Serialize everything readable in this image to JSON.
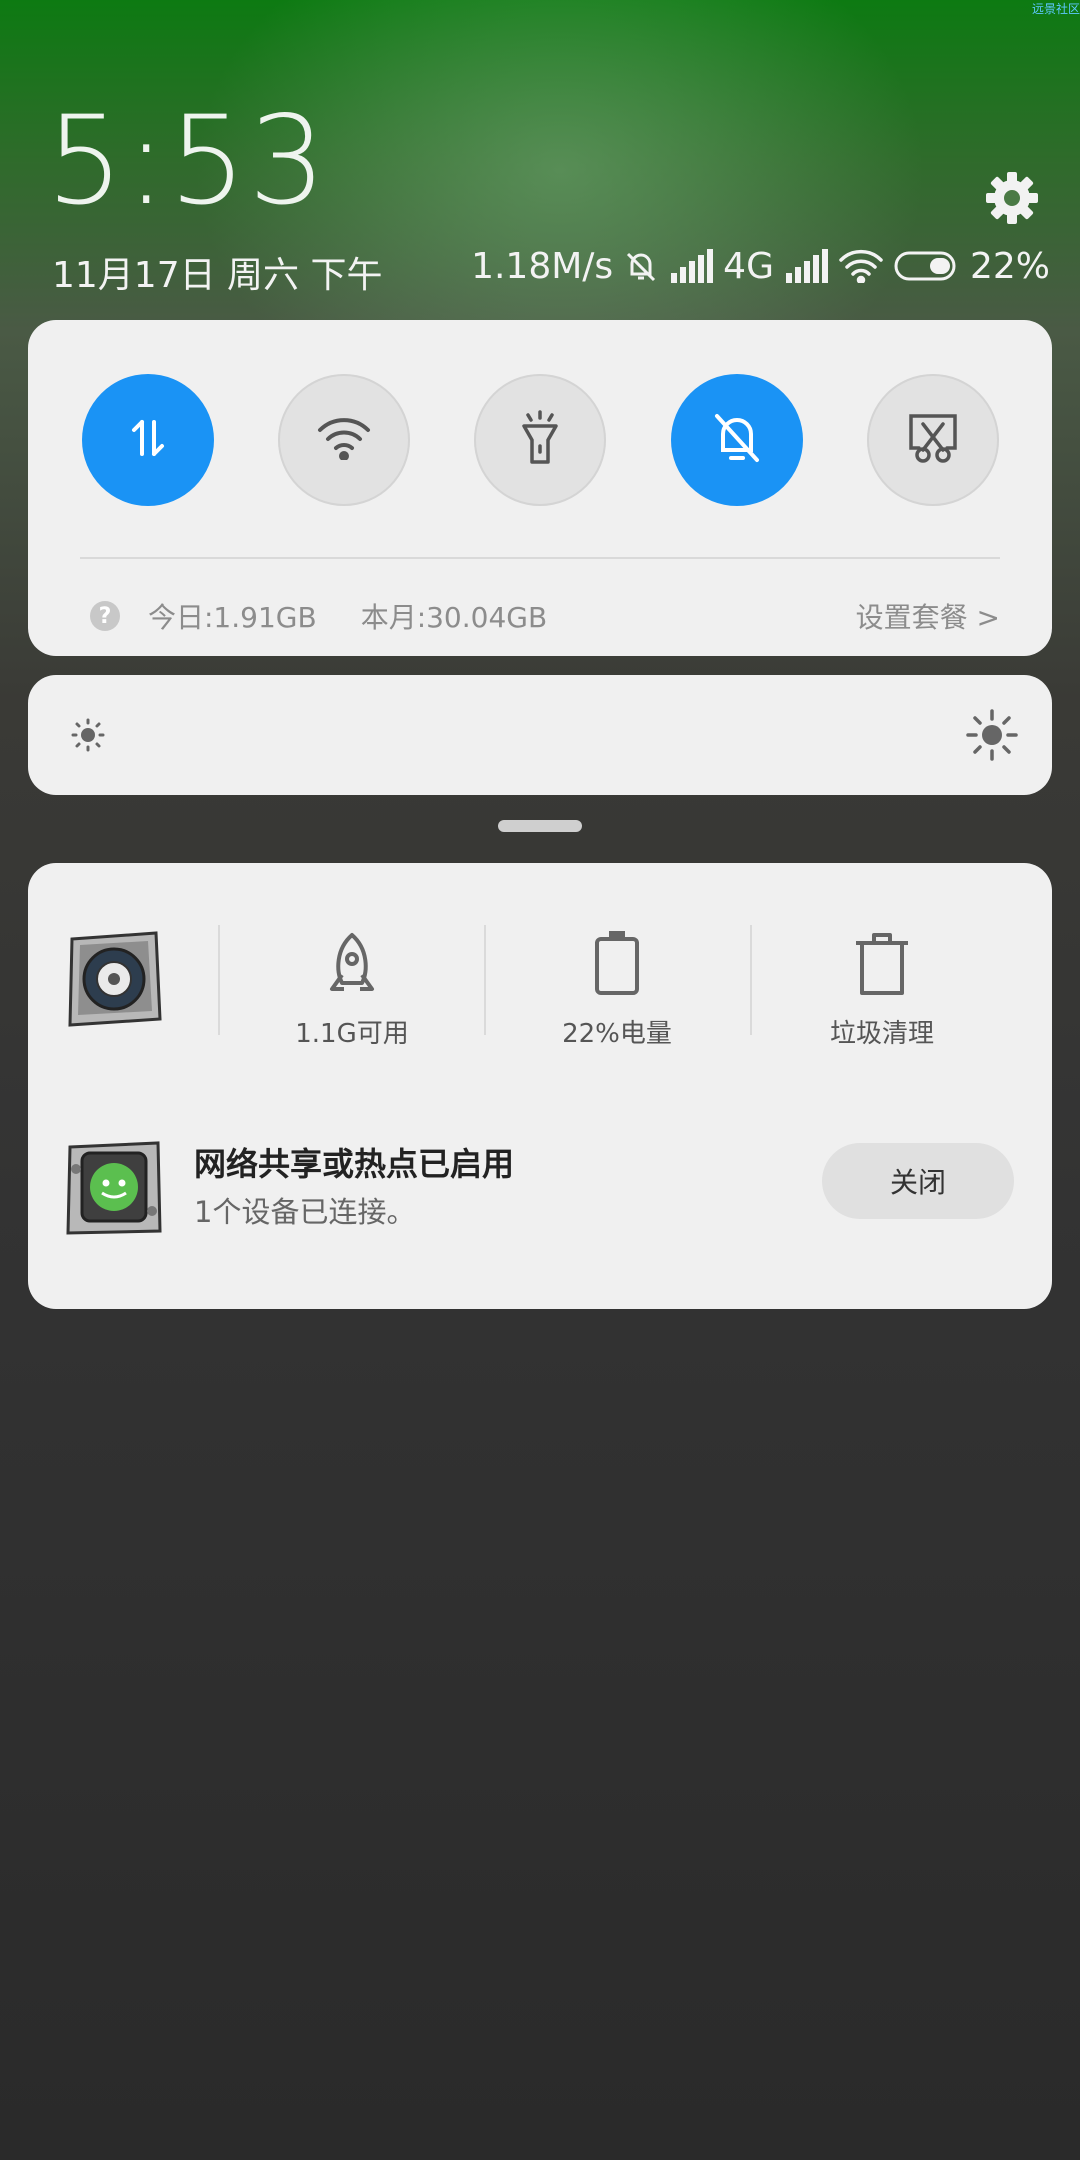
{
  "watermark": "远景社区",
  "lockscreen": {
    "time": "5:53",
    "date": "11月17日 周六 下午"
  },
  "status_bar": {
    "net_speed": "1.18M/s",
    "network_type": "4G",
    "battery_percent": "22%"
  },
  "toggles": [
    {
      "name": "data",
      "icon": "data-transfer-icon",
      "state": "on"
    },
    {
      "name": "wifi",
      "icon": "wifi-icon",
      "state": "off"
    },
    {
      "name": "flashlight",
      "icon": "flashlight-icon",
      "state": "off"
    },
    {
      "name": "silent",
      "icon": "bell-off-icon",
      "state": "on"
    },
    {
      "name": "screenshot",
      "icon": "screenshot-icon",
      "state": "off"
    }
  ],
  "data_usage": {
    "today": "今日:1.91GB",
    "month": "本月:30.04GB",
    "plan_link": "设置套餐 >"
  },
  "brightness": {
    "level": 0.0
  },
  "quick_actions": {
    "memory_label": "1.1G可用",
    "battery_label": "22%电量",
    "cleanup_label": "垃圾清理"
  },
  "notification": {
    "title": "网络共享或热点已启用",
    "body": "1个设备已连接。",
    "close_label": "关闭"
  },
  "colors": {
    "accent": "#1a93f5",
    "card": "#f0f0f0"
  }
}
